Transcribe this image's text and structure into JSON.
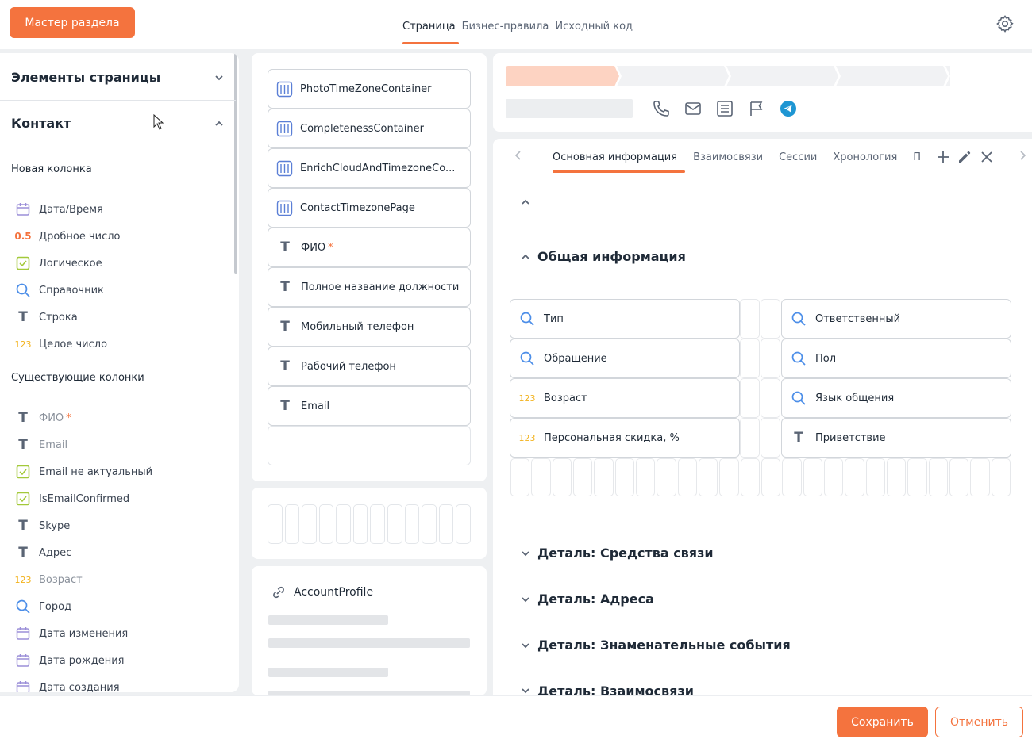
{
  "header": {
    "wizard_button": "Мастер раздела",
    "tabs": [
      {
        "label": "Страница",
        "active": true
      },
      {
        "label": "Бизнес-правила",
        "active": false
      },
      {
        "label": "Исходный код",
        "active": false
      }
    ]
  },
  "left_panel": {
    "page_elements_title": "Элементы страницы",
    "object_title": "Контакт",
    "new_columns_title": "Новая колонка",
    "new_columns": [
      {
        "label": "Дата/Время",
        "icon": "calendar-icon"
      },
      {
        "label": "Дробное число",
        "icon": "decimal-icon",
        "glyph": "0.5"
      },
      {
        "label": "Логическое",
        "icon": "checkbox-icon"
      },
      {
        "label": "Справочник",
        "icon": "lookup-icon"
      },
      {
        "label": "Строка",
        "icon": "text-icon",
        "glyph": "T"
      },
      {
        "label": "Целое число",
        "icon": "integer-icon",
        "glyph": "123"
      }
    ],
    "existing_columns_title": "Существующие колонки",
    "existing_columns": [
      {
        "label": "ФИО",
        "icon": "text-icon",
        "glyph": "T",
        "required": true,
        "dim": true
      },
      {
        "label": "Email",
        "icon": "text-icon",
        "glyph": "T",
        "dim": true
      },
      {
        "label": "Email не актуальный",
        "icon": "checkbox-icon"
      },
      {
        "label": "IsEmailConfirmed",
        "icon": "checkbox-icon"
      },
      {
        "label": "Skype",
        "icon": "text-icon",
        "glyph": "T"
      },
      {
        "label": "Адрес",
        "icon": "text-icon",
        "glyph": "T"
      },
      {
        "label": "Возраст",
        "icon": "integer-icon",
        "glyph": "123",
        "dim": true
      },
      {
        "label": "Город",
        "icon": "lookup-icon"
      },
      {
        "label": "Дата изменения",
        "icon": "calendar-icon"
      },
      {
        "label": "Дата рождения",
        "icon": "calendar-icon"
      },
      {
        "label": "Дата создания",
        "icon": "calendar-icon"
      }
    ],
    "required_mark": "*"
  },
  "middle": {
    "items": [
      {
        "label": "PhotoTimeZoneContainer",
        "icon": "container-icon"
      },
      {
        "label": "CompletenessContainer",
        "icon": "container-icon"
      },
      {
        "label": "EnrichCloudAndTimezoneCo...",
        "icon": "container-icon"
      },
      {
        "label": "ContactTimezonePage",
        "icon": "container-icon"
      },
      {
        "label": "ФИО",
        "icon": "text-icon",
        "glyph": "T",
        "required": true
      },
      {
        "label": "Полное название должности",
        "icon": "text-icon",
        "glyph": "T"
      },
      {
        "label": "Мобильный телефон",
        "icon": "text-icon",
        "glyph": "T"
      },
      {
        "label": "Рабочий телефон",
        "icon": "text-icon",
        "glyph": "T"
      },
      {
        "label": "Email",
        "icon": "text-icon",
        "glyph": "T"
      }
    ],
    "account_profile": "AccountProfile"
  },
  "right": {
    "colors": {
      "accent": "#f4733e",
      "stage_active": "#fdd3c2",
      "stage_inactive": "#f1f2f4",
      "telegram": "#1e96d3"
    },
    "actions": [
      "phone-icon",
      "email-icon",
      "note-icon",
      "flag-icon",
      "telegram-icon"
    ],
    "tabs": [
      {
        "label": "Основная информация",
        "active": true
      },
      {
        "label": "Взаимосвязи",
        "active": false
      },
      {
        "label": "Сессии",
        "active": false
      },
      {
        "label": "Хронология",
        "active": false
      },
      {
        "label": "Прие",
        "active": false
      }
    ],
    "general_section": "Общая информация",
    "fields_left": [
      {
        "label": "Тип",
        "icon": "lookup-icon"
      },
      {
        "label": "Обращение",
        "icon": "lookup-icon"
      },
      {
        "label": "Возраст",
        "icon": "integer-icon",
        "glyph": "123"
      },
      {
        "label": "Персональная скидка, %",
        "icon": "integer-icon",
        "glyph": "123"
      }
    ],
    "fields_right": [
      {
        "label": "Ответственный",
        "icon": "lookup-icon"
      },
      {
        "label": "Пол",
        "icon": "lookup-icon"
      },
      {
        "label": "Язык общения",
        "icon": "lookup-icon"
      },
      {
        "label": "Приветствие",
        "icon": "text-icon",
        "glyph": "T"
      }
    ],
    "details": [
      "Деталь: Средства связи",
      "Деталь: Адреса",
      "Деталь: Знаменательные события",
      "Деталь: Взаимосвязи"
    ]
  },
  "footer": {
    "save": "Сохранить",
    "cancel": "Отменить"
  }
}
